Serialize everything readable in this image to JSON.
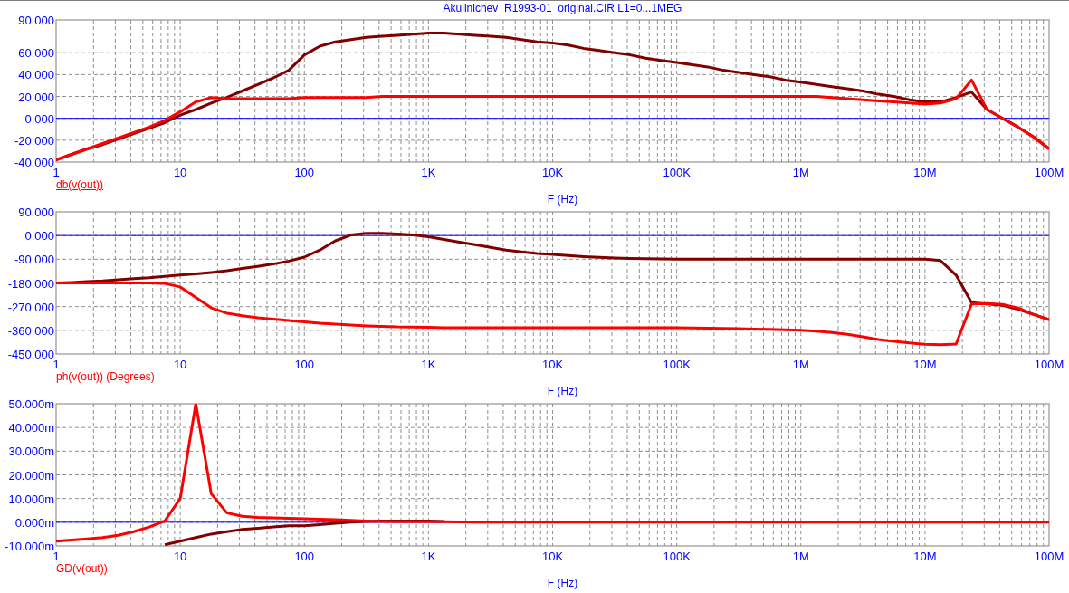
{
  "title": "Akulinichev_R1993-01_original.CIR L1=0...1MEG",
  "charts": [
    {
      "ylabel_underlined": true,
      "chart_data": {
        "type": "line",
        "xlabel": "F (Hz)",
        "ylabel": "db(v(out))",
        "categories": [
          "1",
          null,
          null,
          null,
          null,
          null,
          null,
          null,
          "10",
          null,
          null,
          null,
          null,
          null,
          null,
          null,
          "100",
          null,
          null,
          null,
          null,
          null,
          null,
          null,
          "1K",
          null,
          null,
          null,
          null,
          null,
          null,
          null,
          "10K",
          null,
          null,
          null,
          null,
          null,
          null,
          null,
          "100K",
          null,
          null,
          null,
          null,
          null,
          null,
          null,
          "1M",
          null,
          null,
          null,
          null,
          null,
          null,
          null,
          "10M",
          null,
          null,
          null,
          null,
          null,
          null,
          null,
          "100M"
        ],
        "series": [
          {
            "color": "#800000",
            "values": [
              -38,
              -33,
              -28,
              -24,
              -19,
              -14,
              -9,
              -4,
              3,
              8,
              14,
              19,
              25,
              31,
              37,
              44,
              58,
              66,
              70,
              72,
              74,
              75,
              76,
              77,
              78,
              78,
              77,
              76,
              75,
              74,
              72,
              70,
              69,
              67,
              64,
              62,
              60,
              58,
              55,
              53,
              51,
              49,
              47,
              44,
              42,
              40,
              38,
              35,
              33,
              31,
              29,
              27,
              25,
              22,
              20,
              17,
              15,
              15,
              19,
              24,
              8,
              0,
              -8,
              -17,
              -28
            ]
          },
          {
            "color": "#ff0000",
            "values": [
              -38,
              -33,
              -28,
              -23,
              -18,
              -13,
              -8,
              -2,
              6,
              15,
              19,
              18,
              18,
              18,
              18,
              18,
              19,
              19,
              19,
              19,
              19,
              20,
              20,
              20,
              20,
              20,
              20,
              20,
              20,
              20,
              20,
              20,
              20,
              20,
              20,
              20,
              20,
              20,
              20,
              20,
              20,
              20,
              20,
              20,
              20,
              20,
              20,
              20,
              20,
              20,
              19,
              18,
              17,
              16,
              15,
              14,
              13,
              14,
              18,
              35,
              8,
              0,
              -8,
              -17,
              -28
            ]
          }
        ],
        "ylim": [
          -40,
          90
        ],
        "grid": true,
        "ref_lines": [
          {
            "axis": "y",
            "value": 0,
            "color": "#0000ff"
          }
        ],
        "yticks": [
          {
            "value": 90,
            "label": "90.000"
          },
          {
            "value": 60,
            "label": "60.000"
          },
          {
            "value": 40,
            "label": "40.000"
          },
          {
            "value": 20,
            "label": "20.000"
          },
          {
            "value": 0,
            "label": "0.000"
          },
          {
            "value": -20,
            "label": "-20.000"
          },
          {
            "value": -40,
            "label": "-40.000"
          }
        ]
      }
    },
    {
      "ylabel_underlined": false,
      "chart_data": {
        "type": "line",
        "xlabel": "F (Hz)",
        "ylabel": "ph(v(out)) (Degrees)",
        "categories": [
          "1",
          null,
          null,
          null,
          null,
          null,
          null,
          null,
          "10",
          null,
          null,
          null,
          null,
          null,
          null,
          null,
          "100",
          null,
          null,
          null,
          null,
          null,
          null,
          null,
          "1K",
          null,
          null,
          null,
          null,
          null,
          null,
          null,
          "10K",
          null,
          null,
          null,
          null,
          null,
          null,
          null,
          "100K",
          null,
          null,
          null,
          null,
          null,
          null,
          null,
          "1M",
          null,
          null,
          null,
          null,
          null,
          null,
          null,
          "10M",
          null,
          null,
          null,
          null,
          null,
          null,
          null,
          "100M"
        ],
        "series": [
          {
            "color": "#800000",
            "values": [
              -180,
              -178,
              -175,
              -172,
              -168,
              -164,
              -160,
              -155,
              -150,
              -146,
              -140,
              -134,
              -125,
              -117,
              -108,
              -97,
              -82,
              -55,
              -20,
              2,
              8,
              8,
              6,
              2,
              -5,
              -15,
              -25,
              -35,
              -45,
              -55,
              -62,
              -68,
              -72,
              -76,
              -80,
              -83,
              -85,
              -87,
              -88,
              -89,
              -90,
              -90,
              -90,
              -90,
              -90,
              -90,
              -90,
              -90,
              -90,
              -90,
              -90,
              -90,
              -90,
              -90,
              -90,
              -90,
              -90,
              -95,
              -150,
              -255,
              -260,
              -265,
              -280,
              -300,
              -320
            ]
          },
          {
            "color": "#ff0000",
            "values": [
              -180,
              -180,
              -180,
              -180,
              -180,
              -180,
              -180,
              -182,
              -195,
              -235,
              -275,
              -295,
              -305,
              -312,
              -318,
              -323,
              -328,
              -333,
              -337,
              -340,
              -343,
              -345,
              -347,
              -348,
              -349,
              -350,
              -350,
              -350,
              -350,
              -350,
              -350,
              -350,
              -350,
              -350,
              -350,
              -350,
              -350,
              -350,
              -350,
              -350,
              -350,
              -351,
              -352,
              -353,
              -354,
              -355,
              -356,
              -358,
              -360,
              -363,
              -368,
              -375,
              -385,
              -395,
              -402,
              -408,
              -413,
              -415,
              -412,
              -260,
              -258,
              -262,
              -275,
              -300,
              -320
            ]
          }
        ],
        "ylim": [
          -450,
          90
        ],
        "grid": true,
        "ref_lines": [
          {
            "axis": "y",
            "value": 0,
            "color": "#0000ff"
          }
        ],
        "yticks": [
          {
            "value": 90,
            "label": "90.000"
          },
          {
            "value": 0,
            "label": "0.000"
          },
          {
            "value": -90,
            "label": "-90.000"
          },
          {
            "value": -180,
            "label": "-180.000"
          },
          {
            "value": -270,
            "label": "-270.000"
          },
          {
            "value": -360,
            "label": "-360.000"
          },
          {
            "value": -450,
            "label": "-450.000"
          }
        ]
      }
    },
    {
      "ylabel_underlined": false,
      "chart_data": {
        "type": "line",
        "xlabel": "F (Hz)",
        "ylabel": "GD(v(out))",
        "categories": [
          "1",
          null,
          null,
          null,
          null,
          null,
          null,
          null,
          "10",
          null,
          null,
          null,
          null,
          null,
          null,
          null,
          "100",
          null,
          null,
          null,
          null,
          null,
          null,
          null,
          "1K",
          null,
          null,
          null,
          null,
          null,
          null,
          null,
          "10K",
          null,
          null,
          null,
          null,
          null,
          null,
          null,
          "100K",
          null,
          null,
          null,
          null,
          null,
          null,
          null,
          "1M",
          null,
          null,
          null,
          null,
          null,
          null,
          null,
          "10M",
          null,
          null,
          null,
          null,
          null,
          null,
          null,
          "100M"
        ],
        "series": [
          {
            "color": "#800000",
            "values": [
              null,
              null,
              null,
              null,
              null,
              null,
              null,
              -9.5,
              -8,
              -6.5,
              -5,
              -4,
              -3,
              -2.5,
              -2,
              -1.5,
              -1.5,
              -1,
              -0.5,
              0,
              0.3,
              0.5,
              0.5,
              0.5,
              0.5,
              0.3,
              null,
              null,
              null,
              null,
              null,
              null,
              null,
              null,
              null,
              null,
              null,
              null,
              null,
              null,
              null,
              null,
              null,
              null,
              null,
              null,
              null,
              null,
              null,
              null,
              null,
              null,
              null,
              null,
              null,
              null,
              null,
              null,
              null,
              null,
              null,
              null,
              null,
              null,
              null
            ]
          },
          {
            "color": "#ff0000",
            "values": [
              -8,
              -7.5,
              -7,
              -6.5,
              -5.5,
              -4,
              -2,
              0.5,
              10,
              50,
              12,
              4,
              2.5,
              2,
              1.8,
              1.6,
              1.5,
              1.3,
              1.1,
              0.8,
              0.5,
              0.3,
              0.2,
              0.2,
              0.2,
              0.2,
              0.1,
              0,
              0,
              0,
              0,
              0,
              0,
              0,
              0,
              0,
              0,
              0,
              0,
              0,
              0,
              0,
              0,
              0,
              0,
              0,
              0,
              0,
              0,
              0,
              0,
              0,
              0,
              0,
              0,
              0,
              0,
              0,
              0,
              0,
              0,
              0,
              0,
              0,
              0
            ]
          }
        ],
        "ylim": [
          -10,
          50
        ],
        "grid": true,
        "ref_lines": [
          {
            "axis": "y",
            "value": 0,
            "color": "#0000ff"
          }
        ],
        "yticks": [
          {
            "value": 50,
            "label": "50.000m"
          },
          {
            "value": 40,
            "label": "40.000m"
          },
          {
            "value": 30,
            "label": "30.000m"
          },
          {
            "value": 20,
            "label": "20.000m"
          },
          {
            "value": 10,
            "label": "10.000m"
          },
          {
            "value": 0,
            "label": "0.000m"
          },
          {
            "value": -10,
            "label": "-10.000m"
          }
        ]
      }
    }
  ]
}
